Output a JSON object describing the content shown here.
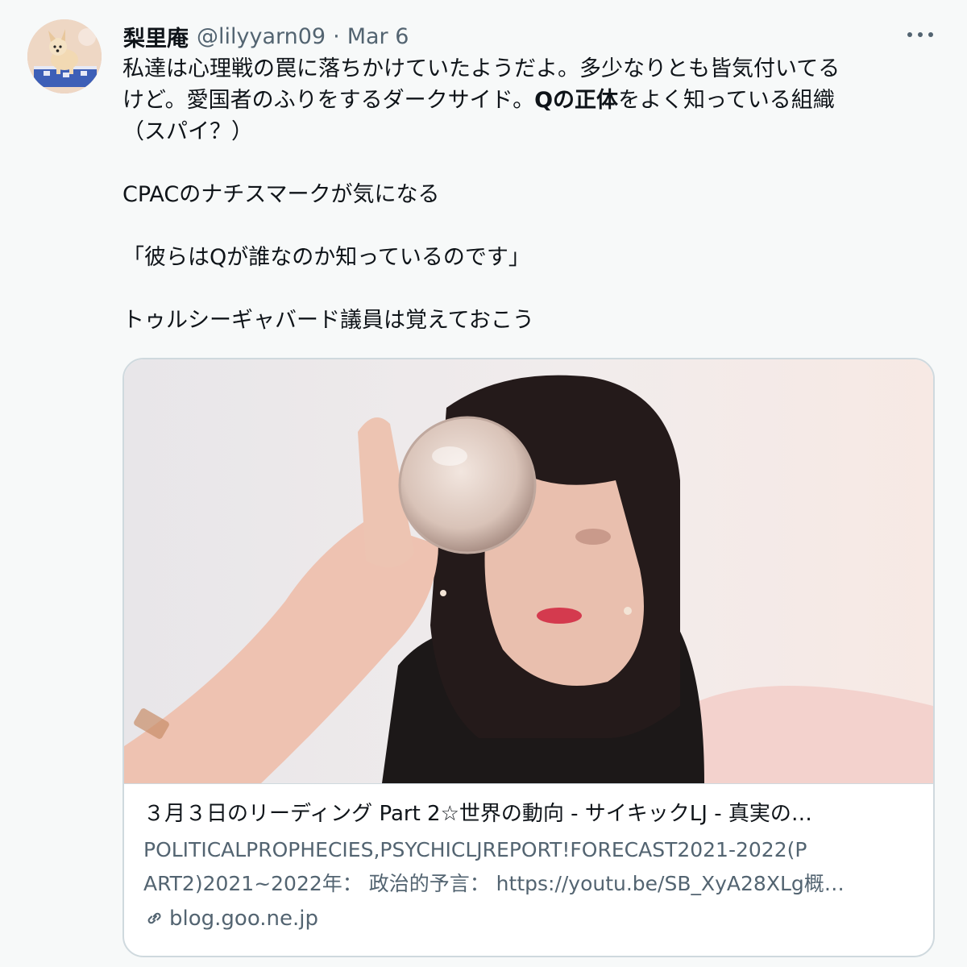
{
  "tweet": {
    "display_name": "梨里庵",
    "handle": "@lilyyarn09",
    "separator": "·",
    "date": "Mar 6",
    "lines": {
      "l1": "私達は心理戦の罠に落ちかけていたようだよ。多少なりとも皆気付いてる",
      "l2_a": "けど。愛国者のふりをするダークサイド。",
      "l2_bold": "Qの正体",
      "l2_b": "をよく知っている組織",
      "l3": "（スパイ？）",
      "l4": "CPACのナチスマークが気になる",
      "l5": "「彼らはQが誰なのか知っているのです」",
      "l6": "トゥルシーギャバード議員は覚えておこう"
    }
  },
  "card": {
    "title": "３月３日のリーディング Part 2☆世界の動向 - サイキックLJ - 真実の…",
    "description_line1": "POLITICALPROPHECIES,PSYCHICLJREPORT!FORECAST2021-2022(P",
    "description_line2": "ART2)2021~2022年：  政治的予言：  https://youtu.be/SB_XyA28XLg概…",
    "domain": "blog.goo.ne.jp"
  },
  "icons": {
    "more": "more-horizontal-icon",
    "link": "link-icon"
  },
  "colors": {
    "text_primary": "#0f1419",
    "text_secondary": "#536471",
    "border": "#cfd9de",
    "background": "#f7f9f9"
  }
}
